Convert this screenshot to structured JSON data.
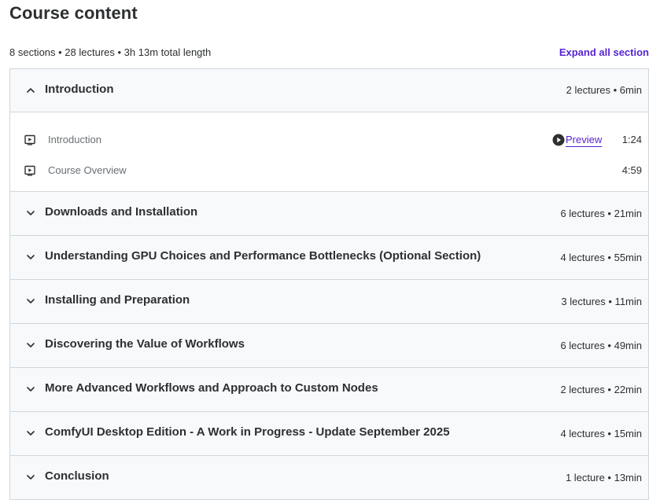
{
  "header": {
    "title": "Course content",
    "summary": "8 sections • 28 lectures • 3h 13m total length",
    "expand_all_label": "Expand all section"
  },
  "colors": {
    "accent": "#5624d0",
    "header_bg": "#f7f9fa",
    "border": "#d1d7dc",
    "text": "#2d2f31",
    "muted": "#6a6f73"
  },
  "sections": [
    {
      "title": "Introduction",
      "meta": "2 lectures • 6min",
      "expanded": true,
      "icon": "chevron-up-icon",
      "lectures": [
        {
          "title": "Introduction",
          "preview_label": "Preview",
          "duration": "1:24",
          "icon": "video-icon"
        },
        {
          "title": "Course Overview",
          "duration": "4:59",
          "icon": "video-icon"
        }
      ]
    },
    {
      "title": "Downloads and Installation",
      "meta": "6 lectures • 21min",
      "expanded": false,
      "icon": "chevron-down-icon"
    },
    {
      "title": "Understanding GPU Choices and Performance Bottlenecks (Optional Section)",
      "meta": "4 lectures • 55min",
      "expanded": false,
      "icon": "chevron-down-icon"
    },
    {
      "title": "Installing and Preparation",
      "meta": "3 lectures • 11min",
      "expanded": false,
      "icon": "chevron-down-icon"
    },
    {
      "title": "Discovering the Value of Workflows",
      "meta": "6 lectures • 49min",
      "expanded": false,
      "icon": "chevron-down-icon"
    },
    {
      "title": "More Advanced Workflows and Approach to Custom Nodes",
      "meta": "2 lectures • 22min",
      "expanded": false,
      "icon": "chevron-down-icon"
    },
    {
      "title": "ComfyUI Desktop Edition - A Work in Progress - Update September 2025",
      "meta": "4 lectures • 15min",
      "expanded": false,
      "icon": "chevron-down-icon"
    },
    {
      "title": "Conclusion",
      "meta": "1 lecture • 13min",
      "expanded": false,
      "icon": "chevron-down-icon"
    }
  ]
}
